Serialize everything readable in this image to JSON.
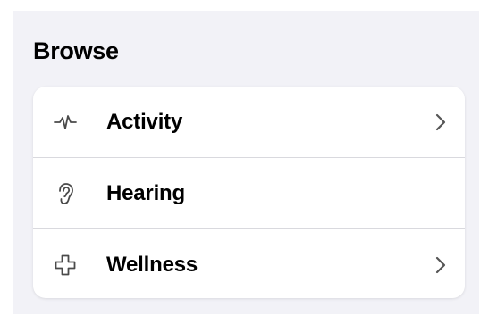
{
  "browse": {
    "title": "Browse",
    "items": [
      {
        "label": "Activity",
        "icon": "activity-waveform-icon",
        "has_chevron": true
      },
      {
        "label": "Hearing",
        "icon": "ear-icon",
        "has_chevron": false
      },
      {
        "label": "Wellness",
        "icon": "wellness-cross-icon",
        "has_chevron": true
      }
    ]
  },
  "colors": {
    "background": "#f2f2f7",
    "card": "#ffffff",
    "text": "#000000",
    "icon": "#4a4a4a",
    "separator": "#d9d9de",
    "chevron": "#555555"
  }
}
